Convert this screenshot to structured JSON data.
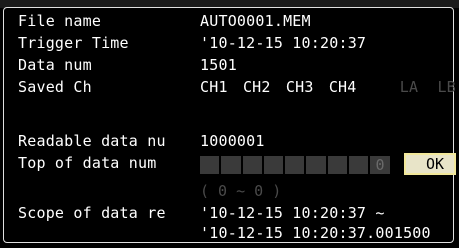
{
  "fields": {
    "file_name": {
      "label": "File name",
      "value": "AUTO0001.MEM"
    },
    "trigger_time": {
      "label": "Trigger Time",
      "value": "'10-12-15 10:20:37"
    },
    "data_num": {
      "label": "Data num",
      "value": "1501"
    },
    "saved_ch": {
      "label": "Saved Ch",
      "channels": [
        "CH1",
        "CH2",
        "CH3",
        "CH4"
      ],
      "disabled_channels": [
        "LA",
        "LB"
      ]
    },
    "readable_data": {
      "label": "Readable data nu",
      "value": "1000001"
    },
    "top_of_data_num": {
      "label": "Top of data num",
      "value": "0",
      "range": "( 0 ~ 0 )"
    },
    "scope_of_data": {
      "label": "Scope of data re",
      "start": "'10-12-15 10:20:37 ~",
      "end": "'10-12-15 10:20:37.001500"
    }
  },
  "ok_button": {
    "label": "OK"
  }
}
